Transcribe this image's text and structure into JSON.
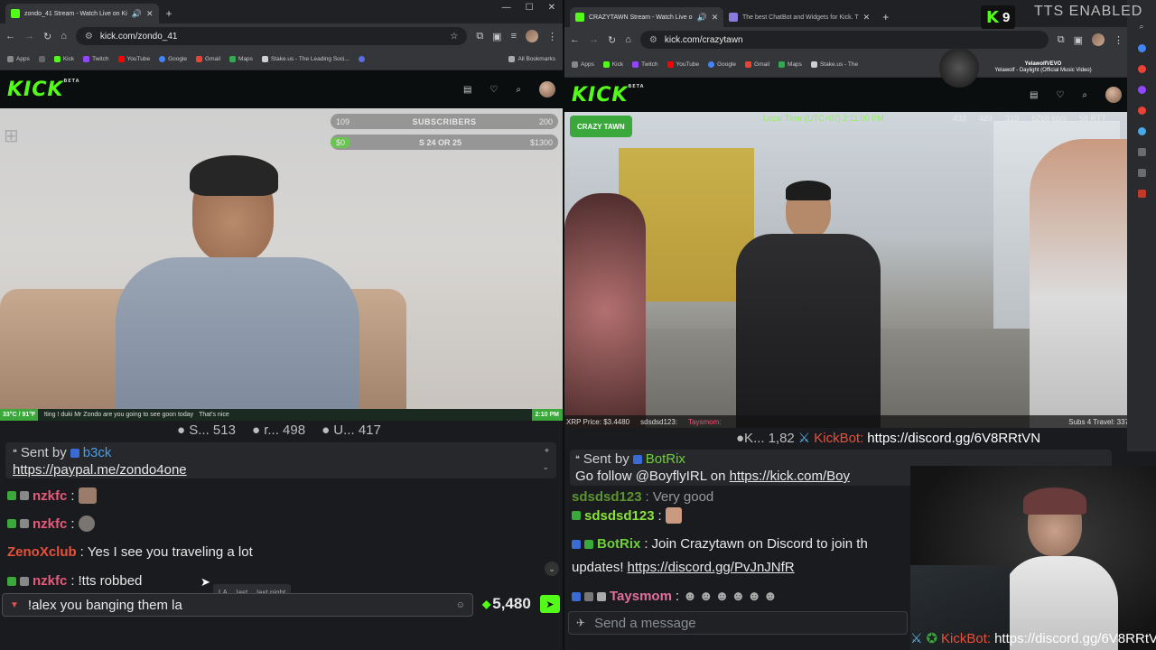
{
  "left": {
    "tab_title": "zondo_41 Stream - Watch Live on Ki",
    "url": "kick.com/zondo_41",
    "bookmarks": [
      "Apps",
      "Kick",
      "Twitch",
      "YouTube",
      "Google",
      "Gmail",
      "Maps",
      "Stake.us - The Leading Soci..."
    ],
    "all_bookmarks": "All Bookmarks",
    "logo": "KICK",
    "logo_sup": "BETA",
    "goal": {
      "sub_left": "109",
      "sub_label": "SUBSCRIBERS",
      "sub_right": "200",
      "money_left": "$0",
      "money_label": "S 24 OR 25",
      "money_right": "$1300"
    },
    "ticker": {
      "temp": "33°C / 91°F",
      "message": "!ting ! duki Mr Zondo are you going to see goon today",
      "reply": "That's nice",
      "time": "2:10 PM"
    },
    "stats": [
      {
        "label": "S...",
        "value": "513"
      },
      {
        "label": "r...",
        "value": "498"
      },
      {
        "label": "U...",
        "value": "417"
      }
    ],
    "pinned": {
      "sent_by": "Sent by",
      "user": "b3ck",
      "link": "https://paypal.me/zondo4one"
    },
    "messages": [
      {
        "user": "nzkfc",
        "text": ""
      },
      {
        "user": "nzkfc",
        "text": ""
      },
      {
        "user": "ZenoXclub",
        "text": "Yes I see you traveling a lot"
      },
      {
        "user": "nzkfc",
        "text": "!tts robbed"
      }
    ],
    "autocomplete": [
      "LA",
      "last",
      "last night"
    ],
    "input_value": "!alex you banging them la",
    "points": "5,480"
  },
  "right": {
    "tab_title": "CRAZYTAWN Stream - Watch Live o",
    "tab2_title": "The best ChatBot and Widgets for Kick. T",
    "url": "kick.com/crazytawn",
    "bookmarks": [
      "Apps",
      "Kick",
      "Twitch",
      "YouTube",
      "Google",
      "Gmail",
      "Maps",
      "Stake.us - The"
    ],
    "logo": "KICK",
    "logo_sup": "BETA",
    "kick_count": "9",
    "tts_label": "TTS ENABLED",
    "now_playing_channel": "YelawolfVEVO",
    "now_playing_title": "Yelawolf - Daylight (Official Music Video)",
    "overlay": {
      "brand": "CRAZY TAWN",
      "local_time": "Local Time (UTC+07) 2:11:00 PM",
      "counts": [
        "433",
        "489",
        "310"
      ],
      "bitrate": "6268 kb/s",
      "rtt": "58 RTT",
      "xrp": "XRP Price: $3.4480",
      "ticker_user": "sdsdsd123:",
      "ticker_user2": "Taysmom:",
      "subs": "Subs 4 Travel: 337 / 340",
      "k_count": "1,82",
      "bot_name": "KickBot:",
      "discord": "https://discord.gg/6V8RRtVN"
    },
    "pinned": {
      "sent_by": "Sent by",
      "user": "BotRix",
      "text": "Go follow @BoyflyIRL on",
      "link": "https://kick.com/Boy"
    },
    "messages": [
      {
        "user": "sdsdsd123",
        "text": "Very good"
      },
      {
        "user": "sdsdsd123",
        "text": ""
      },
      {
        "user": "BotRix",
        "text": "Join Crazytawn on Discord to join th"
      },
      {
        "user": "",
        "text": "updates!",
        "link": "https://discord.gg/PvJnJNfR"
      },
      {
        "user": "Taysmom",
        "text": ""
      }
    ],
    "input_placeholder": "Send a message",
    "bottom_bot": "KickBot:",
    "bottom_link": "https://discord.gg/6V8RRtVN"
  },
  "colors": {
    "kick_green": "#53fc18",
    "chat_bg": "#191b1f",
    "browser_bg": "#35363a"
  }
}
